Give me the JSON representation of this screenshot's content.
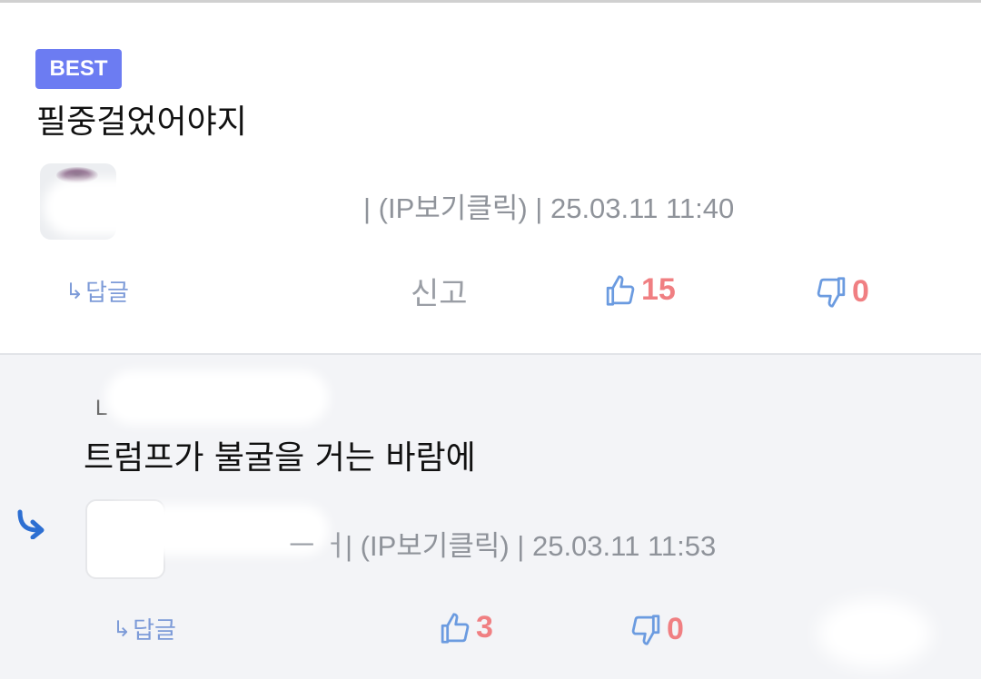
{
  "best_comment": {
    "badge": "BEST",
    "text": "필중걸었어야지",
    "meta": "| (IP보기클릭) | 25.03.11 11:40",
    "reply_label": "답글",
    "report_label": "신고",
    "likes": "15",
    "dislikes": "0"
  },
  "reply_comment": {
    "author_fragment": "L",
    "text": "트럼프가 불굴을 거는 바람에",
    "meta_prefix": "ㅡ ㅓ",
    "meta": "| (IP보기클릭) | 25.03.11 11:53",
    "reply_label": "답글",
    "likes": "3",
    "dislikes": "0"
  },
  "icons": {
    "reply_arrow": "reply-arrow-icon",
    "thumbs_up": "thumbs-up-icon",
    "thumbs_down": "thumbs-down-icon",
    "nested_reply": "nested-reply-icon"
  },
  "colors": {
    "badge": "#6c7cf2",
    "count": "#f07f82",
    "link": "#7d9bd8",
    "reply_bg": "#f3f4f7"
  }
}
